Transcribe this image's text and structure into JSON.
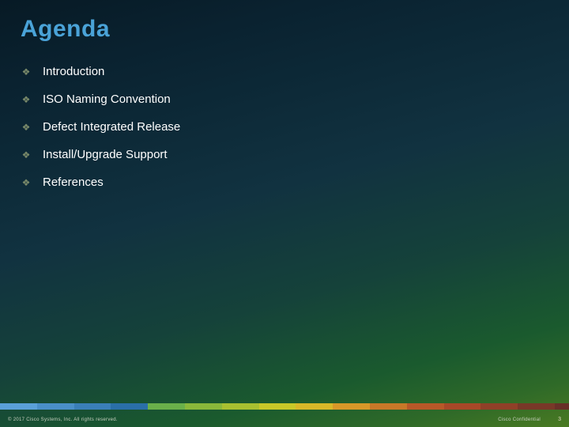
{
  "title": "Agenda",
  "bullet_glyph": "❖",
  "items": [
    {
      "label": "Introduction"
    },
    {
      "label": "ISO Naming Convention"
    },
    {
      "label": "Defect Integrated Release"
    },
    {
      "label": "Install/Upgrade Support"
    },
    {
      "label": "References"
    }
  ],
  "footer": {
    "copyright": "© 2017 Cisco Systems, Inc. All rights reserved.",
    "confidential": "Cisco Confidential",
    "page": "3"
  }
}
